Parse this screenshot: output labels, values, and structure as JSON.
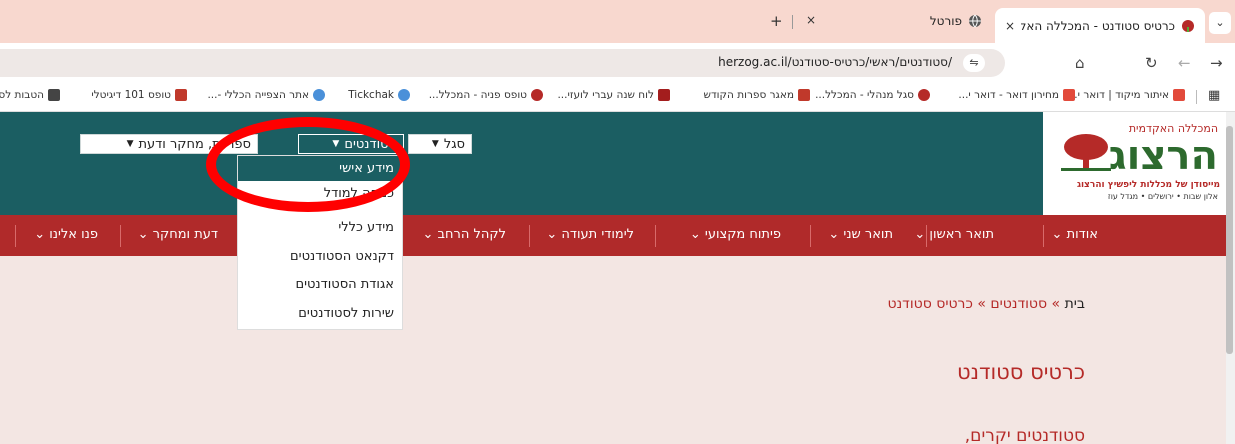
{
  "browser": {
    "tabs": [
      {
        "title": "כרטיס סטודנט - המכללה האקדמית",
        "active": true
      },
      {
        "title": "פורטל",
        "active": false
      }
    ],
    "new_tab": "+",
    "close_glyph": "×",
    "url": "herzog.ac.il/סטודנטים/ראשי/כרטיס-סטודנט/",
    "bookmarks": [
      "איתור מיקוד | דואר י...",
      "מחירון דואר - דואר י...",
      "סגל מנהלי - המכלל...",
      "מאגר ספרות הקודש",
      "לוח שנה עברי לועזי...",
      "טופס פניה - המכלל...",
      "Tickchak",
      "אתר הצפייה הכללי -...",
      "טופס 101 דיגיטלי",
      "הטבות לס"
    ]
  },
  "site": {
    "logo": {
      "line1": "המכללה האקדמית",
      "main": "הרצוג",
      "sub": "מייסודן של מכללות ליפשיץ והרצוג",
      "sub2": "אלון שבות • ירושלים • מגדל עוז"
    },
    "top_menu": [
      {
        "label": "סגל"
      },
      {
        "label": "סטודנטים"
      },
      {
        "label": "ספריות, מחקר ודעת"
      }
    ],
    "dropdown": [
      "מידע אישי",
      "כניסה למודל",
      "מידע כללי",
      "דקנאט הסטודנטים",
      "אגודת הסטודנטים",
      "שירות לסטודנטים"
    ],
    "red_nav": [
      "אודות",
      "תואר ראשון",
      "תואר שני",
      "פיתוח מקצועי",
      "לימודי תעודה",
      "לקהל הרחב",
      "דעת ומחקר",
      "פנו אלינו"
    ],
    "breadcrumb": {
      "home": "בית",
      "sep": "»",
      "section": "סטודנטים",
      "current": "כרטיס סטודנט"
    },
    "page_title": "כרטיס סטודנט",
    "intro": "סטודנטים יקרים,"
  },
  "colors": {
    "teal": "#1b5e62",
    "red": "#b02a2a",
    "annotation": "#ff0000"
  }
}
